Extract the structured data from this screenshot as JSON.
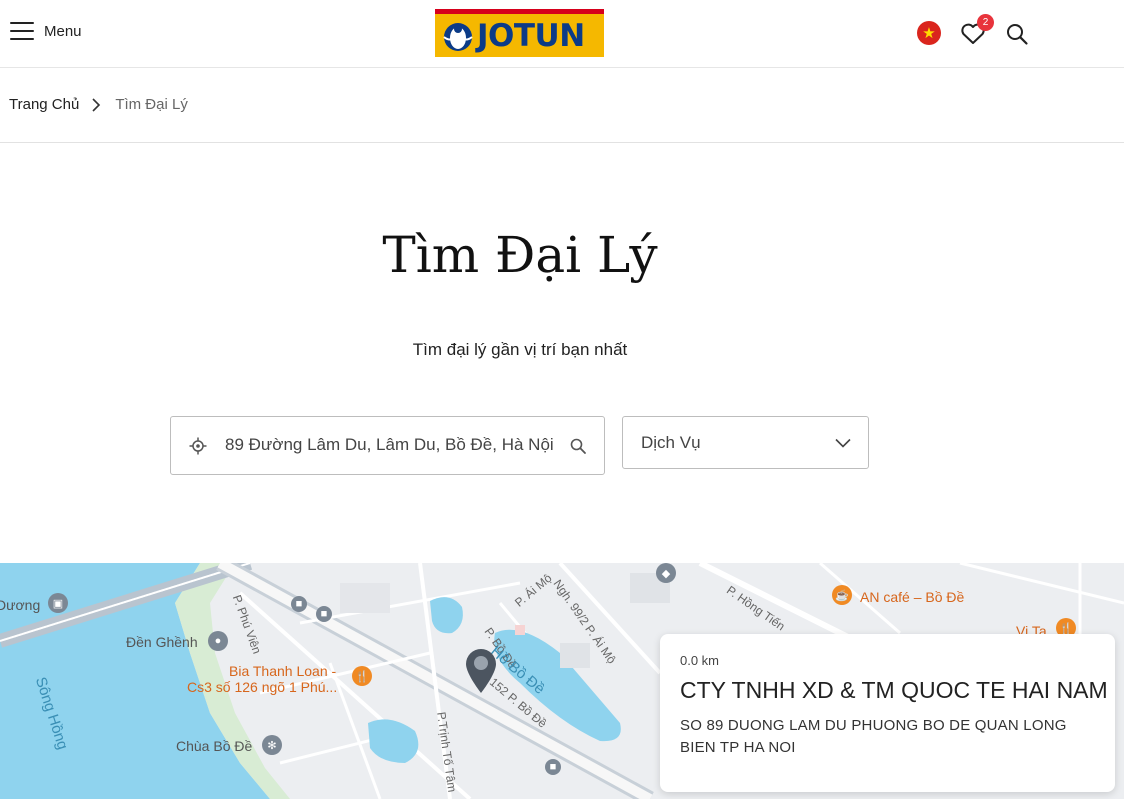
{
  "header": {
    "menu_label": "Menu",
    "logo_text": "JOTUN",
    "wishlist_count": "2",
    "flag_symbol": "★"
  },
  "breadcrumb": {
    "home": "Trang Chủ",
    "current": "Tìm Đại Lý"
  },
  "main": {
    "title": "Tìm Đại Lý",
    "subtitle": "Tìm đại lý gần vị trí bạn nhất",
    "search_value": "89 Đường Lâm Du, Lâm Du, Bồ Đề, Hà Nội",
    "service_label": "Dịch Vụ"
  },
  "map": {
    "labels": {
      "duong": "Dương",
      "song_hong": "Sông Hồng",
      "den_ghenh": "Đền Ghềnh",
      "pho_phu_vien": "P. Phú Viên",
      "bia_line1": "Bia Thanh Loan -",
      "bia_line2": "Cs3 số 126 ngõ 1 Phú...",
      "chua_bo_de": "Chùa Bồ Đề",
      "pho_ai_mo": "P. Ái Mộ",
      "ngo_99": "Ngh. 99/2 P. Ái Mộ",
      "pho_bo_de": "P. Bồ Đề",
      "ho_bo_de": "Hồ Bồ Đề",
      "so_152": "152 P. Bồ Đề",
      "pho_trinh_to_tam": "P.Trịnh Tố Tâm",
      "pho_hong_tien": "P. Hồng Tiến",
      "an_cafe": "AN café – Bồ Đề",
      "vi_ta": "Vi Ta"
    }
  },
  "dealer": {
    "distance": "0.0 km",
    "name": "CTY TNHH XD & TM QUOC TE HAI NAM",
    "address": "SO 89 DUONG LAM DU PHUONG BO DE QUAN LONG BIEN TP HA NOI"
  },
  "colors": {
    "logo_bg": "#f5b800",
    "logo_red": "#d6001c",
    "logo_blue": "#0b3b87",
    "badge": "#e8343c",
    "water": "#8fd3ee",
    "map_bg": "#eceef1"
  }
}
